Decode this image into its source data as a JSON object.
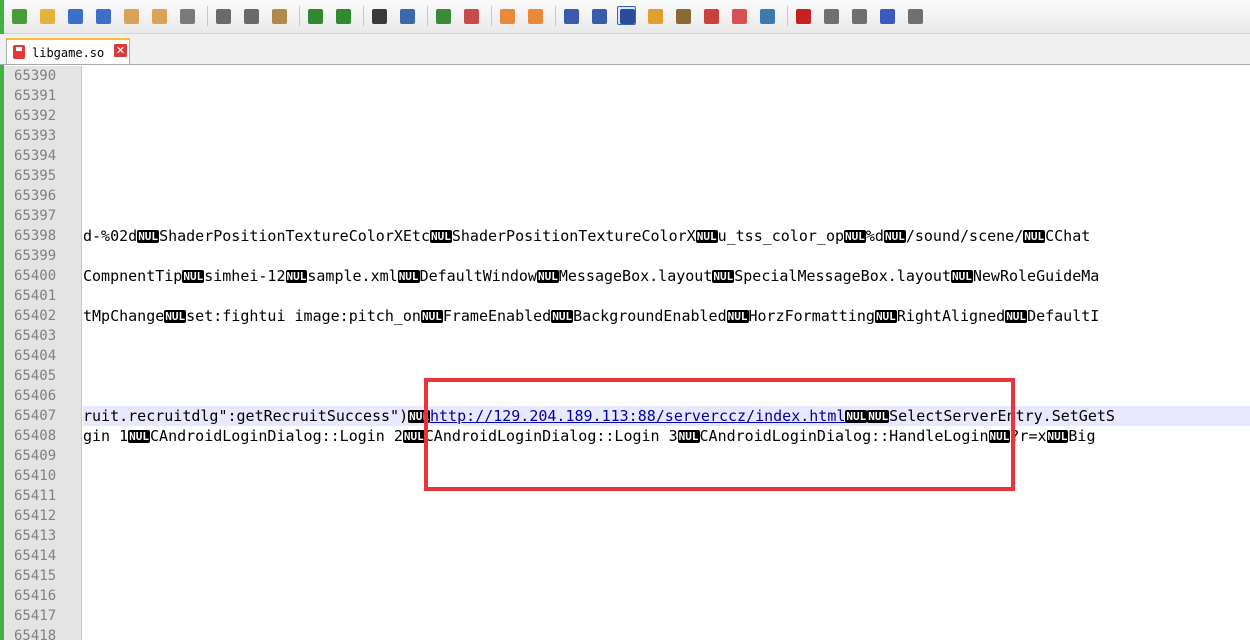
{
  "toolbar": {
    "buttons": [
      {
        "name": "new-file-icon",
        "color": "#4a9c3a"
      },
      {
        "name": "open-file-icon",
        "color": "#e8b13a"
      },
      {
        "name": "save-icon",
        "color": "#3b6fc9"
      },
      {
        "name": "save-all-icon",
        "color": "#3b6fc9"
      },
      {
        "name": "close-icon",
        "color": "#d9a45a"
      },
      {
        "name": "close-all-icon",
        "color": "#d9a45a"
      },
      {
        "name": "print-icon",
        "color": "#7a7a7a"
      },
      {
        "name": "cut-icon",
        "color": "#6a6a6a"
      },
      {
        "name": "copy-icon",
        "color": "#6a6a6a"
      },
      {
        "name": "paste-icon",
        "color": "#b08a4a"
      },
      {
        "name": "undo-icon",
        "color": "#2f8a2f"
      },
      {
        "name": "redo-icon",
        "color": "#2f8a2f"
      },
      {
        "name": "find-icon",
        "color": "#3a3a3a"
      },
      {
        "name": "replace-icon",
        "color": "#3a6aaa"
      },
      {
        "name": "zoom-in-icon",
        "color": "#3a8a3a"
      },
      {
        "name": "zoom-out-icon",
        "color": "#c84a4a"
      },
      {
        "name": "sync-vertical-icon",
        "color": "#e88a3a"
      },
      {
        "name": "sync-horizontal-icon",
        "color": "#e88a3a"
      },
      {
        "name": "word-wrap-icon",
        "color": "#3a5aaa"
      },
      {
        "name": "show-all-chars-icon",
        "color": "#3a5aaa"
      },
      {
        "name": "indent-guide-icon",
        "color": "#2a4a9a"
      },
      {
        "name": "user-language-icon",
        "color": "#e0a030"
      },
      {
        "name": "doc-map-icon",
        "color": "#8a6a30"
      },
      {
        "name": "function-list-icon",
        "color": "#c84040"
      },
      {
        "name": "folder-workspace-icon",
        "color": "#d85050"
      },
      {
        "name": "monitor-icon",
        "color": "#3a7ab0"
      },
      {
        "name": "record-macro-icon",
        "color": "#c82020"
      },
      {
        "name": "stop-macro-icon",
        "color": "#707070"
      },
      {
        "name": "play-macro-icon",
        "color": "#707070"
      },
      {
        "name": "run-macro-multiple-icon",
        "color": "#3a5ac0"
      },
      {
        "name": "save-macro-icon",
        "color": "#707070"
      }
    ]
  },
  "tab": {
    "title": "libgame.so",
    "close_glyph": "✕"
  },
  "nul_label": "NUL",
  "lines": [
    {
      "num": "65390",
      "segments": []
    },
    {
      "num": "65391",
      "segments": []
    },
    {
      "num": "65392",
      "segments": []
    },
    {
      "num": "65393",
      "segments": []
    },
    {
      "num": "65394",
      "segments": []
    },
    {
      "num": "65395",
      "segments": []
    },
    {
      "num": "65396",
      "segments": []
    },
    {
      "num": "65397",
      "segments": []
    },
    {
      "num": "65398",
      "segments": [
        {
          "t": "d-%02d"
        },
        {
          "nul": true
        },
        {
          "t": "ShaderPositionTextureColorXEtc"
        },
        {
          "nul": true
        },
        {
          "t": "ShaderPositionTextureColorX"
        },
        {
          "nul": true
        },
        {
          "t": "u_tss_color_op"
        },
        {
          "nul": true
        },
        {
          "t": "%d"
        },
        {
          "nul": true
        },
        {
          "t": "/sound/scene/"
        },
        {
          "nul": true
        },
        {
          "t": "CChat"
        }
      ]
    },
    {
      "num": "65399",
      "segments": []
    },
    {
      "num": "65400",
      "segments": [
        {
          "t": "CompnentTip"
        },
        {
          "nul": true
        },
        {
          "t": "simhei-12"
        },
        {
          "nul": true
        },
        {
          "t": "sample.xml"
        },
        {
          "nul": true
        },
        {
          "t": "DefaultWindow"
        },
        {
          "nul": true
        },
        {
          "t": "MessageBox.layout"
        },
        {
          "nul": true
        },
        {
          "t": "SpecialMessageBox.layout"
        },
        {
          "nul": true
        },
        {
          "t": "NewRoleGuideMa"
        }
      ]
    },
    {
      "num": "65401",
      "segments": []
    },
    {
      "num": "65402",
      "segments": [
        {
          "t": "tMpChange"
        },
        {
          "nul": true
        },
        {
          "t": "set:fightui image:pitch_on"
        },
        {
          "nul": true
        },
        {
          "t": "FrameEnabled"
        },
        {
          "nul": true
        },
        {
          "t": "BackgroundEnabled"
        },
        {
          "nul": true
        },
        {
          "t": "HorzFormatting"
        },
        {
          "nul": true
        },
        {
          "t": "RightAligned"
        },
        {
          "nul": true
        },
        {
          "t": "DefaultI"
        }
      ]
    },
    {
      "num": "65403",
      "segments": []
    },
    {
      "num": "65404",
      "segments": []
    },
    {
      "num": "65405",
      "segments": []
    },
    {
      "num": "65406",
      "segments": []
    },
    {
      "num": "65407",
      "segments": [
        {
          "t": "ruit.recruitdlg\":getRecruitSuccess\")"
        },
        {
          "nul": true
        },
        {
          "t": "http://129.204.189.113:88/serverccz/index.html",
          "url": true
        },
        {
          "nul": true
        },
        {
          "nul": true
        },
        {
          "t": "SelectServerEntry.SetGetS"
        }
      ]
    },
    {
      "num": "65408",
      "segments": [
        {
          "t": "gin 1"
        },
        {
          "nul": true
        },
        {
          "t": "CAndroidLoginDialog::Login 2"
        },
        {
          "nul": true
        },
        {
          "t": "CAndroidLoginDialog::Login 3"
        },
        {
          "nul": true
        },
        {
          "t": "CAndroidLoginDialog::HandleLogin"
        },
        {
          "nul": true
        },
        {
          "t": "?r=x"
        },
        {
          "nul": true
        },
        {
          "t": "Big"
        }
      ]
    },
    {
      "num": "65409",
      "segments": []
    },
    {
      "num": "65410",
      "segments": []
    },
    {
      "num": "65411",
      "segments": []
    },
    {
      "num": "65412",
      "segments": []
    },
    {
      "num": "65413",
      "segments": []
    },
    {
      "num": "65414",
      "segments": []
    },
    {
      "num": "65415",
      "segments": []
    },
    {
      "num": "65416",
      "segments": []
    },
    {
      "num": "65417",
      "segments": []
    },
    {
      "num": "65418",
      "segments": []
    }
  ],
  "current_line": "65407",
  "annotation_color": "#e8343a"
}
